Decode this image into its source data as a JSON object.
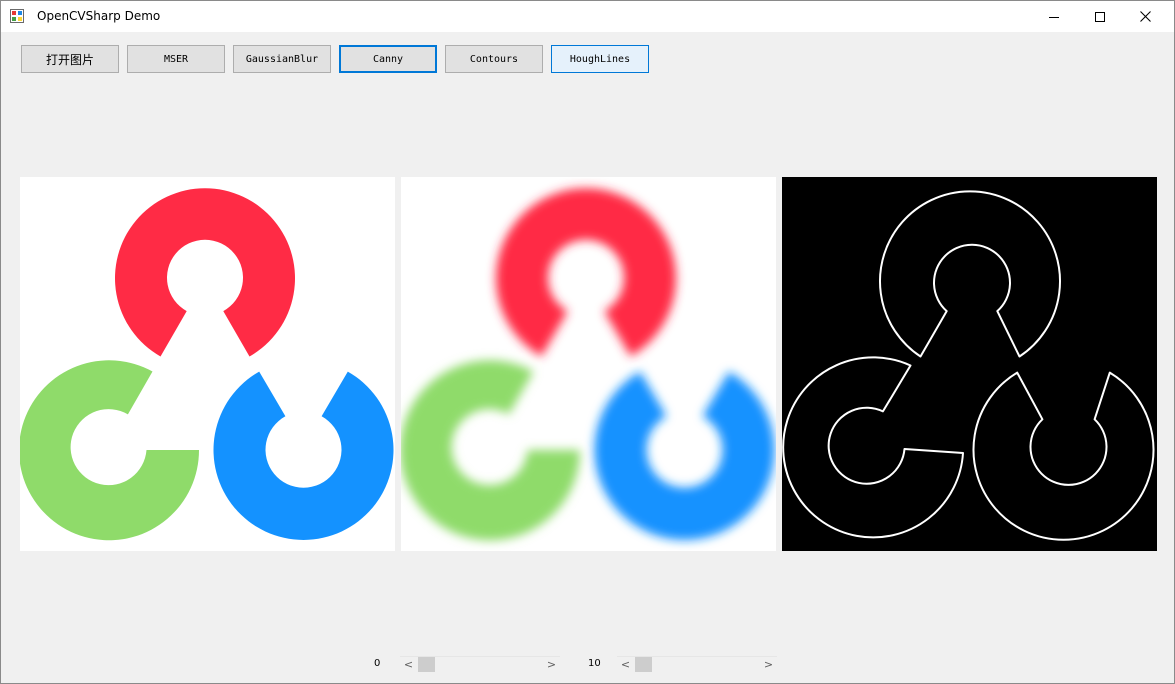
{
  "window": {
    "title": "OpenCVSharp Demo",
    "app_icon": "app-icon",
    "controls": [
      "minimize-icon",
      "maximize-icon",
      "close-icon"
    ]
  },
  "toolbar": {
    "buttons": [
      {
        "label": "打开图片"
      },
      {
        "label": "MSER"
      },
      {
        "label": "GaussianBlur"
      },
      {
        "label": "Canny"
      },
      {
        "label": "Contours"
      },
      {
        "label": "HoughLines"
      }
    ]
  },
  "panels": [
    {
      "content": "original-opencv-logo"
    },
    {
      "content": "gaussian-blurred-logo"
    },
    {
      "content": "canny-edges-logo"
    }
  ],
  "sliders": [
    {
      "value_label": "0",
      "value": 0
    },
    {
      "value_label": "10",
      "value": 0
    }
  ],
  "colors": {
    "red": "#ff2b45",
    "green": "#8fdb6a",
    "blue": "#1492ff",
    "accent": "#0078d7",
    "window_bg": "#f0f0f0"
  }
}
